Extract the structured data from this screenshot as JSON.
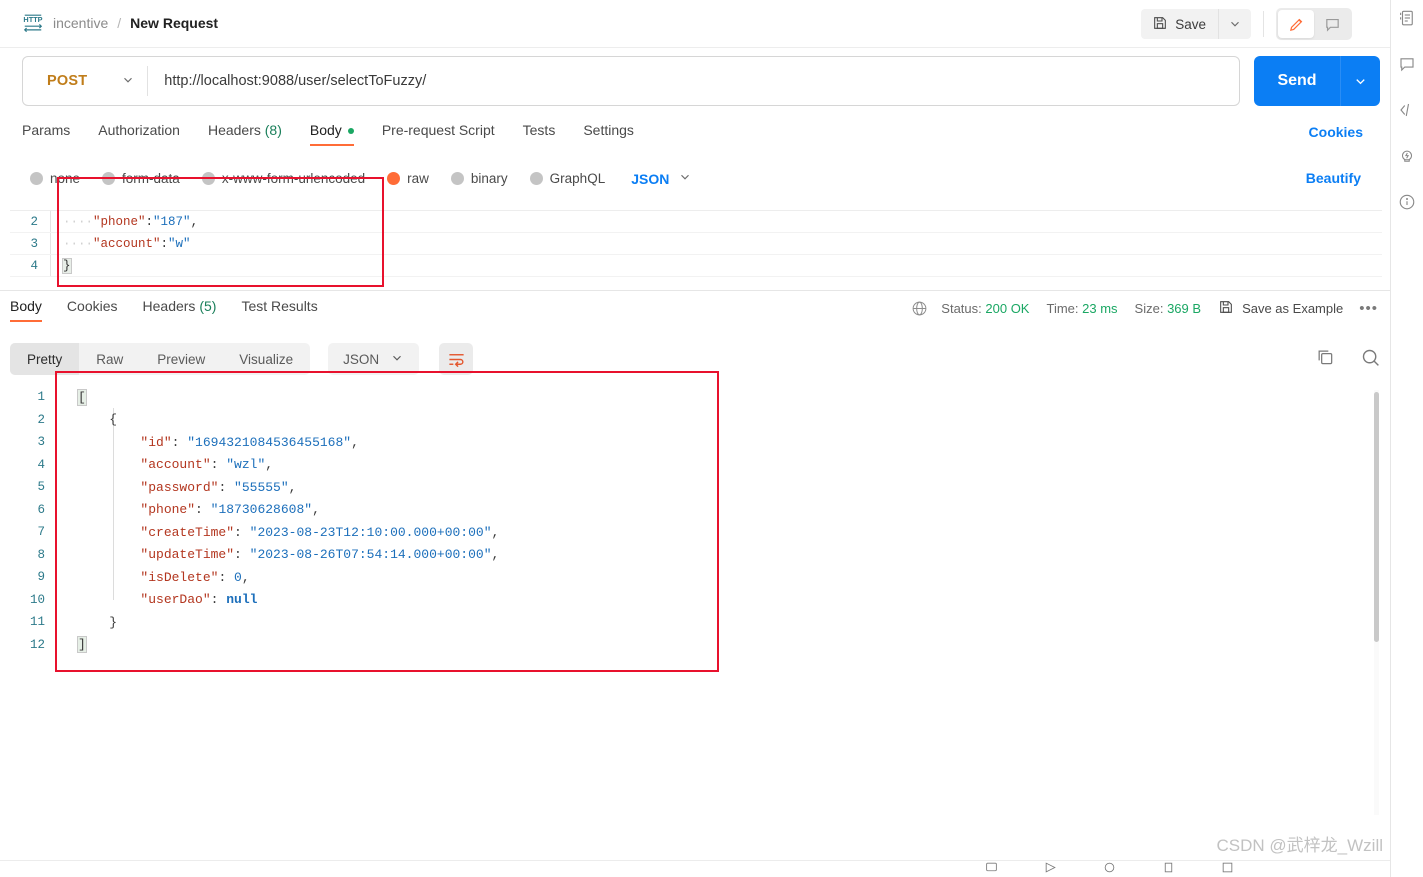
{
  "header": {
    "protocol_badge": "HTTP",
    "collection": "incentive",
    "separator": "/",
    "request_name": "New Request",
    "save_label": "Save"
  },
  "url_bar": {
    "method": "POST",
    "url": "http://localhost:9088/user/selectToFuzzy/",
    "send_label": "Send"
  },
  "request_tabs": [
    {
      "label": "Params",
      "active": false
    },
    {
      "label": "Authorization",
      "active": false
    },
    {
      "label": "Headers",
      "count": "(8)",
      "active": false
    },
    {
      "label": "Body",
      "active": true,
      "dot": true
    },
    {
      "label": "Pre-request Script",
      "active": false
    },
    {
      "label": "Tests",
      "active": false
    },
    {
      "label": "Settings",
      "active": false
    }
  ],
  "links": {
    "cookies": "Cookies",
    "beautify": "Beautify"
  },
  "body_types": [
    {
      "label": "none",
      "selected": false
    },
    {
      "label": "form-data",
      "selected": false
    },
    {
      "label": "x-www-form-urlencoded",
      "selected": false
    },
    {
      "label": "raw",
      "selected": true
    },
    {
      "label": "binary",
      "selected": false
    },
    {
      "label": "GraphQL",
      "selected": false
    }
  ],
  "body_format": "JSON",
  "request_body_lines": [
    {
      "num": "2",
      "indent": "····",
      "key": "\"phone\"",
      "colon": ":",
      "value": "\"187\"",
      "tail": ","
    },
    {
      "num": "3",
      "indent": "····",
      "key": "\"account\"",
      "colon": ":",
      "value": "\"w\"",
      "tail": ""
    },
    {
      "num": "4",
      "indent": "",
      "key": "",
      "colon": "",
      "value": "",
      "tail": "}"
    }
  ],
  "response": {
    "tabs": [
      {
        "label": "Body",
        "active": true
      },
      {
        "label": "Cookies",
        "active": false
      },
      {
        "label": "Headers",
        "count": "(5)",
        "active": false
      },
      {
        "label": "Test Results",
        "active": false
      }
    ],
    "status_label": "Status:",
    "status_value": "200 OK",
    "time_label": "Time:",
    "time_value": "23 ms",
    "size_label": "Size:",
    "size_value": "369 B",
    "save_as_example": "Save as Example",
    "more_menu": "•••",
    "view_modes": [
      {
        "label": "Pretty",
        "active": true
      },
      {
        "label": "Raw",
        "active": false
      },
      {
        "label": "Preview",
        "active": false
      },
      {
        "label": "Visualize",
        "active": false
      }
    ],
    "format": "JSON",
    "body_lines": [
      {
        "num": "1",
        "text": "[",
        "type": "bracket"
      },
      {
        "num": "2",
        "text": "    {",
        "type": "bracket"
      },
      {
        "num": "3",
        "key": "\"id\"",
        "value": "\"1694321084536455168\"",
        "vtype": "str",
        "comma": ","
      },
      {
        "num": "4",
        "key": "\"account\"",
        "value": "\"wzl\"",
        "vtype": "str",
        "comma": ","
      },
      {
        "num": "5",
        "key": "\"password\"",
        "value": "\"55555\"",
        "vtype": "str",
        "comma": ","
      },
      {
        "num": "6",
        "key": "\"phone\"",
        "value": "\"18730628608\"",
        "vtype": "str",
        "comma": ","
      },
      {
        "num": "7",
        "key": "\"createTime\"",
        "value": "\"2023-08-23T12:10:00.000+00:00\"",
        "vtype": "str",
        "comma": ","
      },
      {
        "num": "8",
        "key": "\"updateTime\"",
        "value": "\"2023-08-26T07:54:14.000+00:00\"",
        "vtype": "str",
        "comma": ","
      },
      {
        "num": "9",
        "key": "\"isDelete\"",
        "value": "0",
        "vtype": "num",
        "comma": ","
      },
      {
        "num": "10",
        "key": "\"userDao\"",
        "value": "null",
        "vtype": "null",
        "comma": ""
      },
      {
        "num": "11",
        "text": "    }",
        "type": "plain"
      },
      {
        "num": "12",
        "text": "]",
        "type": "bracket"
      }
    ]
  },
  "watermark": "CSDN @武梓龙_Wzill",
  "colors": {
    "accent_orange": "#ff6c37",
    "link_blue": "#0b7ef4",
    "status_green": "#1aa763",
    "method_orange": "#c07d1a",
    "annotation_red": "#e8112d"
  }
}
